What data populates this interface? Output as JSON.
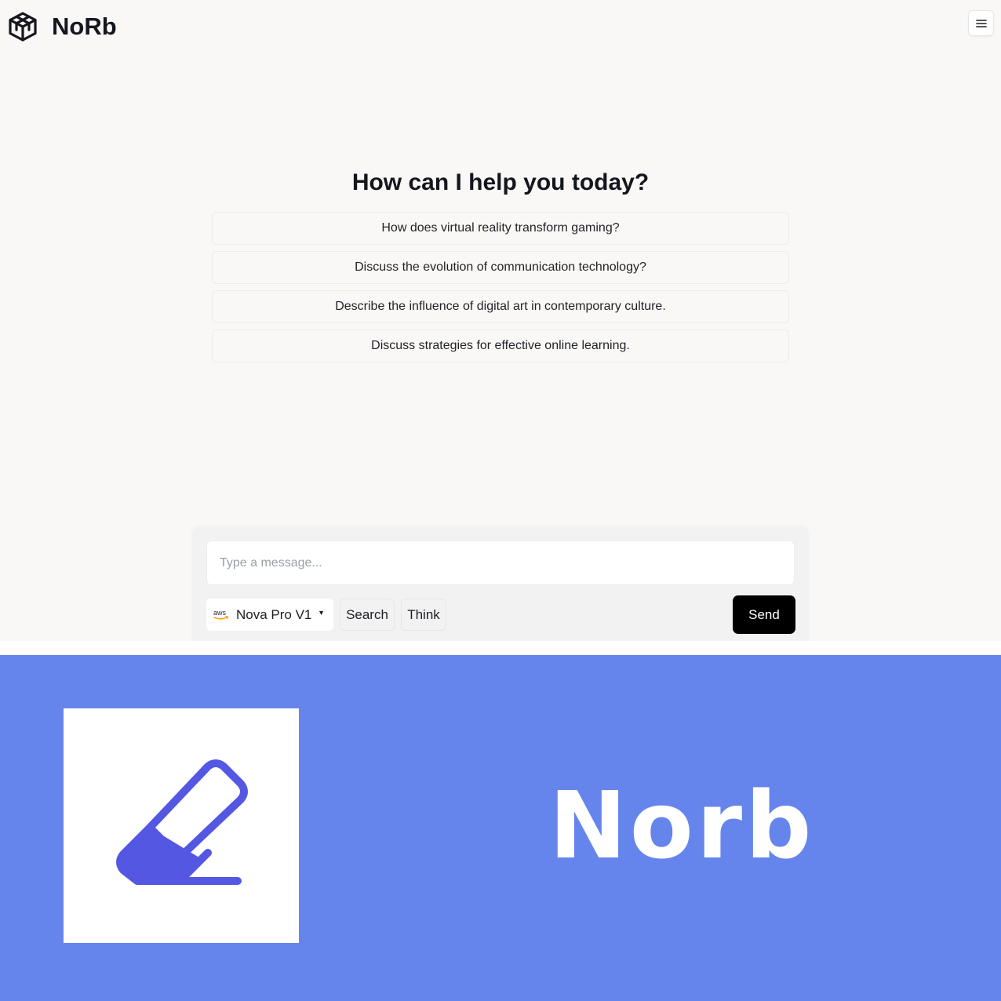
{
  "app": {
    "brand": "NoRb",
    "logo_icon": "cube-icon",
    "menu_icon": "hamburger-menu-icon"
  },
  "main": {
    "heading": "How can I help you today?",
    "suggestions": [
      "How does virtual reality transform gaming?",
      "Discuss the evolution of communication technology?",
      "Describe the influence of digital art in contemporary culture.",
      "Discuss strategies for effective online learning."
    ]
  },
  "composer": {
    "placeholder": "Type a message...",
    "value": "",
    "model": {
      "provider_icon": "aws-icon",
      "provider_text": "aws",
      "label": "Nova Pro V1"
    },
    "search_label": "Search",
    "think_label": "Think",
    "send_label": "Send"
  },
  "banner": {
    "icon": "eraser-icon",
    "title": "Norb",
    "colors": {
      "background": "#6685ec",
      "icon": "#5457e2"
    }
  }
}
